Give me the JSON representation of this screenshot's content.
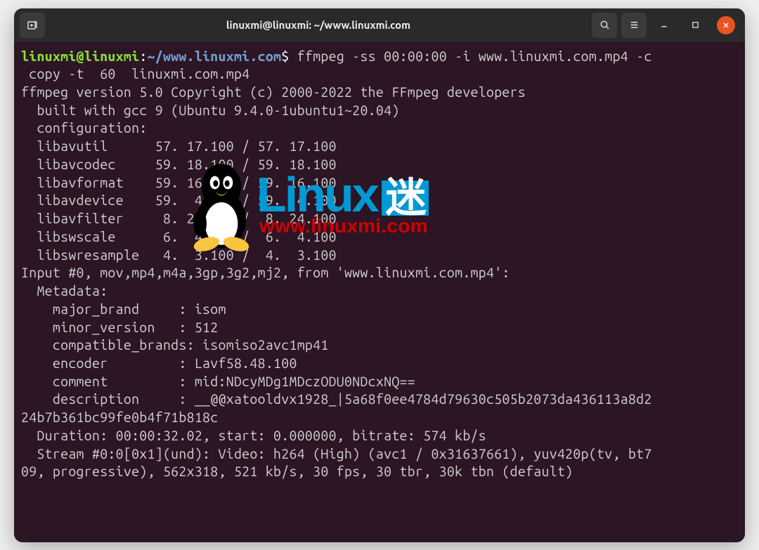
{
  "window": {
    "title": "linuxmi@linuxmi: ~/www.linuxmi.com"
  },
  "prompt": {
    "user": "linuxmi@linuxmi",
    "sep1": ":",
    "path": "~/www.linuxmi.com",
    "sep2": "$",
    "command": "ffmpeg -ss 00:00:00 -i www.linuxmi.com.mp4 -c",
    "command2": " copy -t  60  linuxmi.com.mp4"
  },
  "output": {
    "l01": "ffmpeg version 5.0 Copyright (c) 2000-2022 the FFmpeg developers",
    "l02": "  built with gcc 9 (Ubuntu 9.4.0-1ubuntu1~20.04)",
    "l03": "  configuration:",
    "l04": "  libavutil      57. 17.100 / 57. 17.100",
    "l05": "  libavcodec     59. 18.100 / 59. 18.100",
    "l06": "  libavformat    59. 16.100 / 59. 16.100",
    "l07": "  libavdevice    59.  4.100 / 59.  4.100",
    "l08": "  libavfilter     8. 24.100 /  8. 24.100",
    "l09": "  libswscale      6.  4.100 /  6.  4.100",
    "l10": "  libswresample   4.  3.100 /  4.  3.100",
    "l11": "Input #0, mov,mp4,m4a,3gp,3g2,mj2, from 'www.linuxmi.com.mp4':",
    "l12": "  Metadata:",
    "l13": "    major_brand     : isom",
    "l14": "    minor_version   : 512",
    "l15": "    compatible_brands: isomiso2avc1mp41",
    "l16": "    encoder         : Lavf58.48.100",
    "l17": "    comment         : mid:NDcyMDg1MDczODU0NDcxNQ==",
    "l18": "    description     : __@@xatooldvx1928_|5a68f0ee4784d79630c505b2073da436113a8d2",
    "l19": "24b7b361bc99fe0b4f71b818c",
    "l20": "  Duration: 00:00:32.02, start: 0.000000, bitrate: 574 kb/s",
    "l21": "  Stream #0:0[0x1](und): Video: h264 (High) (avc1 / 0x31637661), yuv420p(tv, bt7",
    "l22": "09, progressive), 562x318, 521 kb/s, 30 fps, 30 tbr, 30k tbn (default)"
  },
  "watermark": {
    "text": "Linux",
    "cn": "迷",
    "url": "www.linuxmi.com"
  }
}
